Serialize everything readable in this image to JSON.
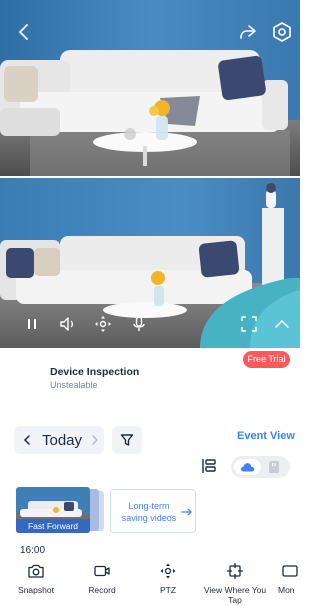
{
  "top_bar": {
    "back_icon": "chevron-left-icon",
    "share_icon": "share-icon",
    "settings_icon": "settings-hexagon-icon"
  },
  "player_controls": {
    "icons": [
      "pause-icon",
      "speaker-icon",
      "ptz-icon",
      "microphone-icon",
      "fullscreen-icon",
      "chevron-up-icon"
    ]
  },
  "device": {
    "name": "Device Inspection",
    "status": "Unstealable",
    "trial_badge": "Free Trial"
  },
  "date_nav": {
    "label": "Today",
    "filter_icon": "filter-icon",
    "event_view": "Event View"
  },
  "storage": {
    "selected": "cloud",
    "options": [
      "cloud-icon",
      "sd-card-icon"
    ]
  },
  "clips": {
    "thumbnail_label": "Fast Forward",
    "longterm_label": "Long-term saving videos",
    "time_label": "16:00"
  },
  "toolbar": {
    "items": [
      {
        "label": "Snapshot",
        "icon": "camera-icon"
      },
      {
        "label": "Record",
        "icon": "video-record-icon"
      },
      {
        "label": "PTZ",
        "icon": "ptz-icon"
      },
      {
        "label": "View Where You Tap",
        "icon": "crosshair-icon"
      },
      {
        "label": "Mon",
        "icon": "monitor-icon"
      }
    ]
  },
  "colors": {
    "accent": "#3d83f5",
    "trial": "#ff5a5a",
    "wall": "#3f7fb5"
  }
}
